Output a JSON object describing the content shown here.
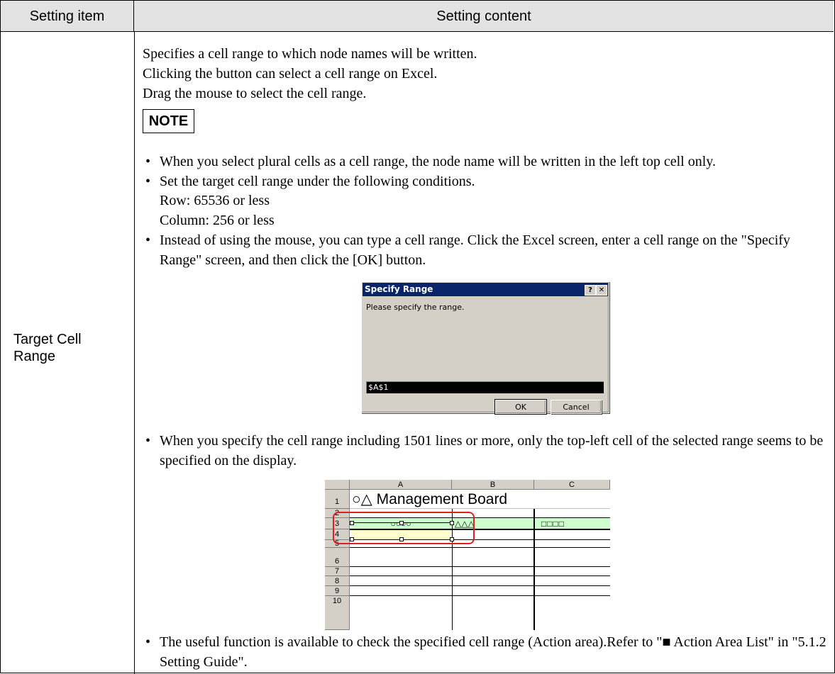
{
  "header": {
    "item": "Setting item",
    "content": "Setting content"
  },
  "row": {
    "item_label": "Target Cell Range",
    "intro": [
      "Specifies a cell range to which node names will be written.",
      "Clicking the button can select a cell range on Excel.",
      "Drag the mouse to select the cell range."
    ],
    "note_label": "NOTE",
    "bullet_char": "•",
    "bullets": [
      "When you select plural cells as a cell range, the node name will be written in the left top cell only.",
      "Set the target cell range under the following conditions.",
      "Instead of using the mouse, you can type a cell range. Click the Excel screen, enter a cell range on the \"Specify Range\" screen, and then click the [OK] button.",
      "When you specify the cell range including 1501 lines or more, only the top-left cell of the selected range seems to be specified on the display.",
      "The useful function is available to check the specified cell range (Action area).Refer to \"■ Action Area List\" in \"5.1.2 Setting Guide\"."
    ],
    "conditions": [
      "Row: 65536 or less",
      "Column: 256 or less"
    ]
  },
  "dialog": {
    "title": "Specify Range",
    "help_btn": "?",
    "close_btn": "✕",
    "message": "Please specify the range.",
    "input_value": "$A$1",
    "ok_label": "OK",
    "cancel_label": "Cancel"
  },
  "sheet": {
    "columns": [
      "A",
      "B",
      "C"
    ],
    "rows": [
      "1",
      "2",
      "3",
      "4",
      "5",
      "6",
      "7",
      "8",
      "9",
      "10"
    ],
    "title_cell": "○△ Management Board",
    "row3": [
      "○○○○",
      "△△△",
      "□□□□"
    ]
  },
  "colors": {
    "header_bg": "#e3e3e3",
    "dialog_title_bg": "#0a246a",
    "selection_outline": "#e02020",
    "row3_bg": "#ccffcc",
    "selected_cell_bg": "#ffffcc"
  }
}
